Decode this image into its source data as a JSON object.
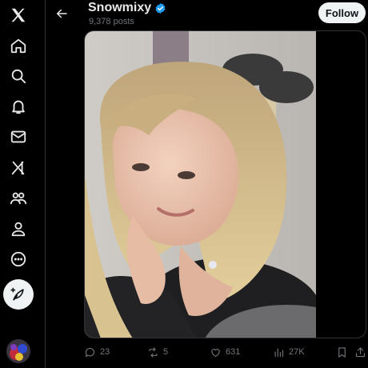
{
  "nav": {
    "items": [
      {
        "icon": "x-logo-icon"
      },
      {
        "icon": "home-icon"
      },
      {
        "icon": "search-icon"
      },
      {
        "icon": "notifications-icon"
      },
      {
        "icon": "messages-icon"
      },
      {
        "icon": "grok-icon"
      },
      {
        "icon": "communities-icon"
      },
      {
        "icon": "profile-icon"
      },
      {
        "icon": "more-icon"
      }
    ],
    "compose_icon": "compose-icon"
  },
  "header": {
    "name": "Snowmixy",
    "posts": "9,378 posts",
    "follow_label": "Follow",
    "verified_color": "#1d9bf0"
  },
  "actions": {
    "replies": "23",
    "reposts": "5",
    "likes": "631",
    "views": "27K"
  },
  "colors": {
    "background": "#000000",
    "text": "#e7e9ea",
    "muted": "#71767b",
    "border": "#2f3336"
  }
}
